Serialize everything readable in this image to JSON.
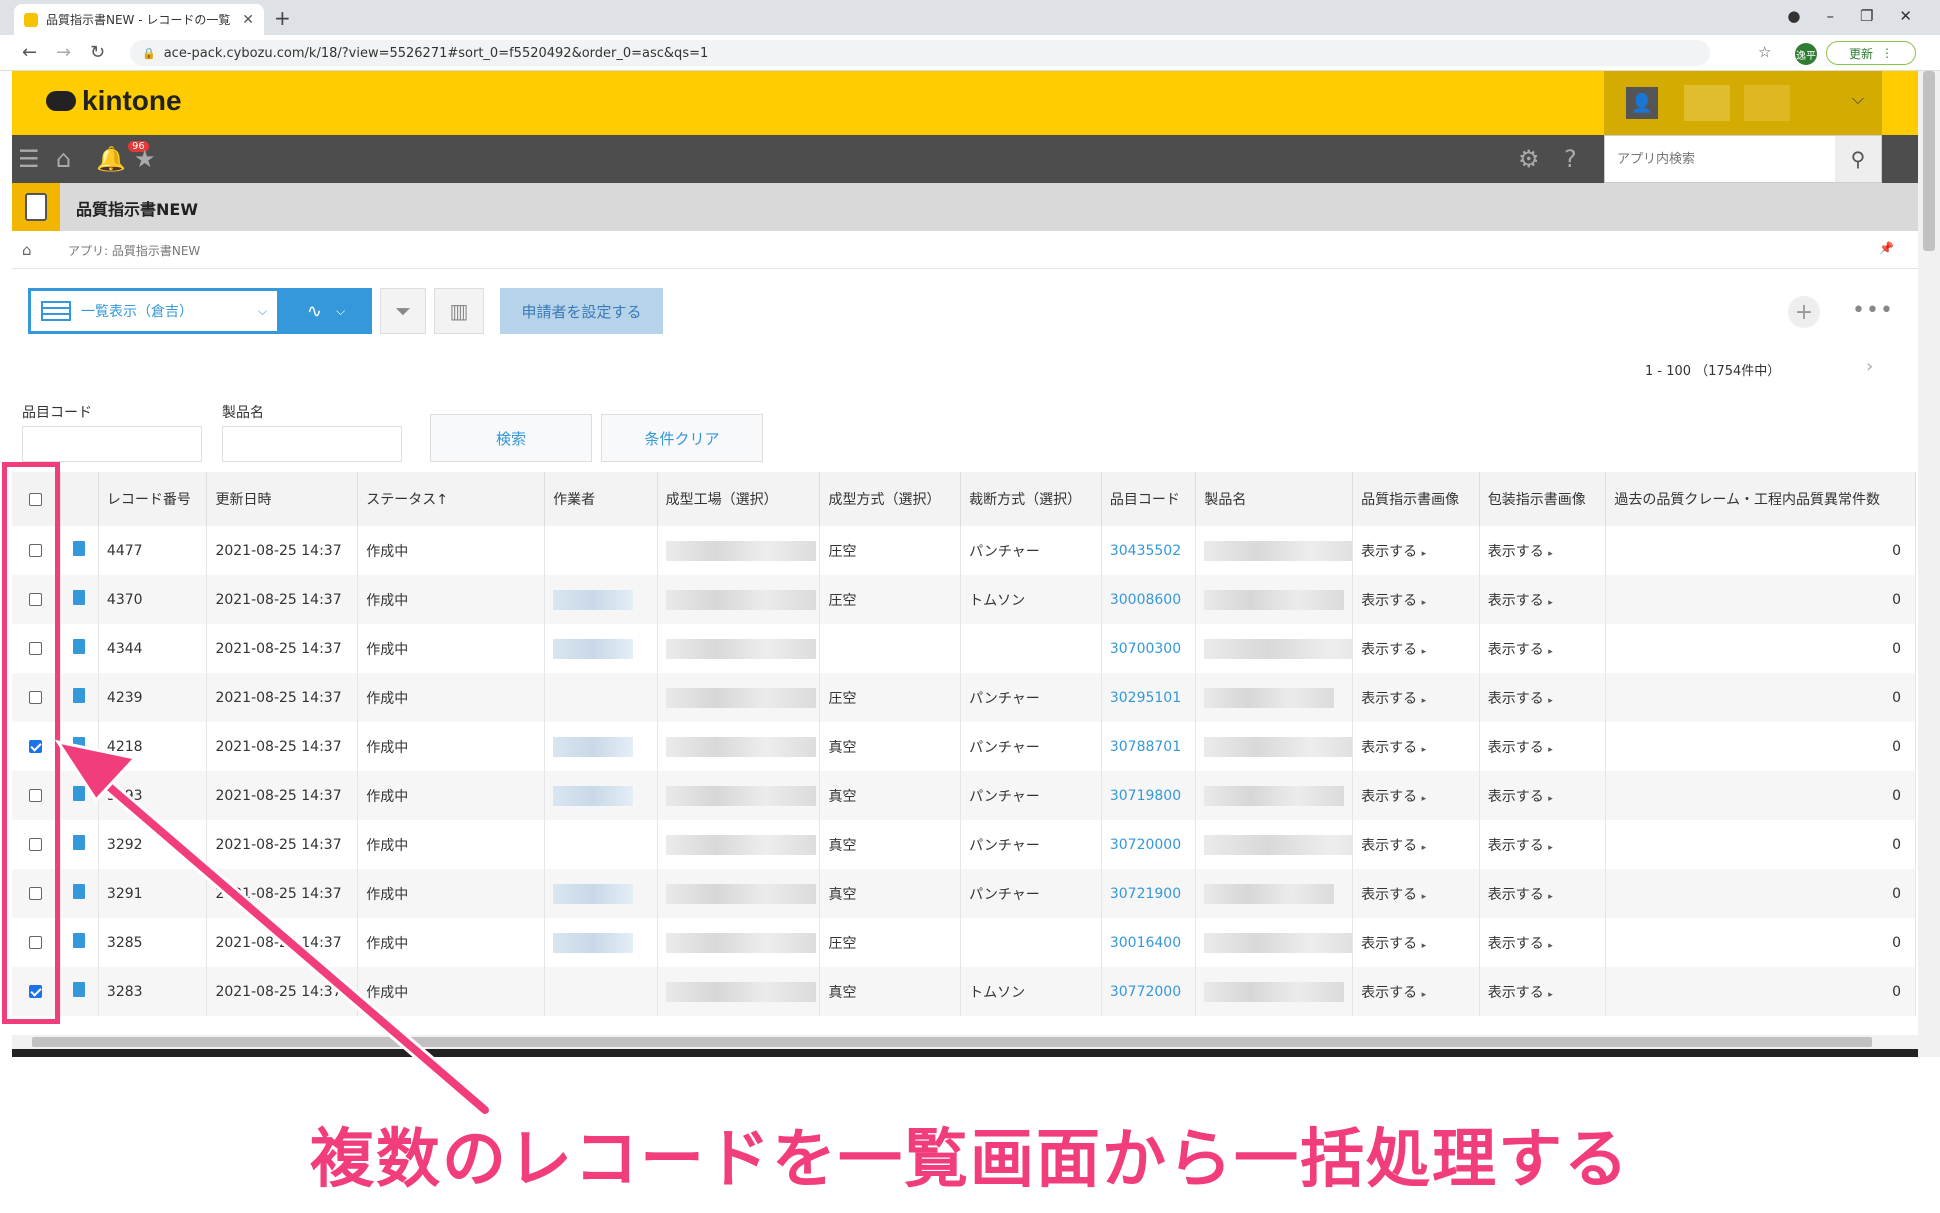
{
  "browser": {
    "tab_title": "品質指示書NEW - レコードの一覧",
    "url": "ace-pack.cybozu.com/k/18/?view=5526271#sort_0=f5520492&order_0=asc&qs=1",
    "profile_initial": "逸平",
    "update_label": "更新"
  },
  "header": {
    "logo": "kintone",
    "notification_count": "96",
    "search_placeholder": "アプリ内検索"
  },
  "app": {
    "title": "品質指示書NEW",
    "breadcrumb": "アプリ: 品質指示書NEW"
  },
  "toolbar": {
    "view_name": "一覧表示（倉吉）",
    "action_button": "申請者を設定する",
    "pager": "1 - 100 （1754件中）"
  },
  "search_form": {
    "field1_label": "品目コード",
    "field2_label": "製品名",
    "search_button": "検索",
    "clear_button": "条件クリア"
  },
  "table": {
    "columns": [
      "レコード番号",
      "更新日時",
      "ステータス↑",
      "作業者",
      "成型工場（選択）",
      "成型方式（選択）",
      "裁断方式（選択）",
      "品目コード",
      "製品名",
      "品質指示書画像",
      "包装指示書画像",
      "過去の品質クレーム・工程内品質異常件数"
    ],
    "rows": [
      {
        "id": "4477",
        "date": "2021-08-25 14:37",
        "status": "作成中",
        "molding": "圧空",
        "cutting": "パンチャー",
        "code": "30435502",
        "img1": "表示する",
        "img2": "表示する",
        "count": "0",
        "checked": false
      },
      {
        "id": "4370",
        "date": "2021-08-25 14:37",
        "status": "作成中",
        "molding": "圧空",
        "cutting": "トムソン",
        "code": "30008600",
        "img1": "表示する",
        "img2": "表示する",
        "count": "0",
        "checked": false
      },
      {
        "id": "4344",
        "date": "2021-08-25 14:37",
        "status": "作成中",
        "molding": "",
        "cutting": "",
        "code": "30700300",
        "img1": "表示する",
        "img2": "表示する",
        "count": "0",
        "checked": false
      },
      {
        "id": "4239",
        "date": "2021-08-25 14:37",
        "status": "作成中",
        "molding": "圧空",
        "cutting": "パンチャー",
        "code": "30295101",
        "img1": "表示する",
        "img2": "表示する",
        "count": "0",
        "checked": false
      },
      {
        "id": "4218",
        "date": "2021-08-25 14:37",
        "status": "作成中",
        "molding": "真空",
        "cutting": "パンチャー",
        "code": "30788701",
        "img1": "表示する",
        "img2": "表示する",
        "count": "0",
        "checked": true
      },
      {
        "id": "3293",
        "date": "2021-08-25 14:37",
        "status": "作成中",
        "molding": "真空",
        "cutting": "パンチャー",
        "code": "30719800",
        "img1": "表示する",
        "img2": "表示する",
        "count": "0",
        "checked": false
      },
      {
        "id": "3292",
        "date": "2021-08-25 14:37",
        "status": "作成中",
        "molding": "真空",
        "cutting": "パンチャー",
        "code": "30720000",
        "img1": "表示する",
        "img2": "表示する",
        "count": "0",
        "checked": false
      },
      {
        "id": "3291",
        "date": "2021-08-25 14:37",
        "status": "作成中",
        "molding": "真空",
        "cutting": "パンチャー",
        "code": "30721900",
        "img1": "表示する",
        "img2": "表示する",
        "count": "0",
        "checked": false
      },
      {
        "id": "3285",
        "date": "2021-08-25 14:37",
        "status": "作成中",
        "molding": "圧空",
        "cutting": "",
        "code": "30016400",
        "img1": "表示する",
        "img2": "表示する",
        "count": "0",
        "checked": false
      },
      {
        "id": "3283",
        "date": "2021-08-25 14:37",
        "status": "作成中",
        "molding": "真空",
        "cutting": "トムソン",
        "code": "30772000",
        "img1": "表示する",
        "img2": "表示する",
        "count": "0",
        "checked": true
      }
    ]
  },
  "annotation": {
    "caption": "複数のレコードを一覧画面から一括処理する",
    "color": "#f23d7d"
  }
}
